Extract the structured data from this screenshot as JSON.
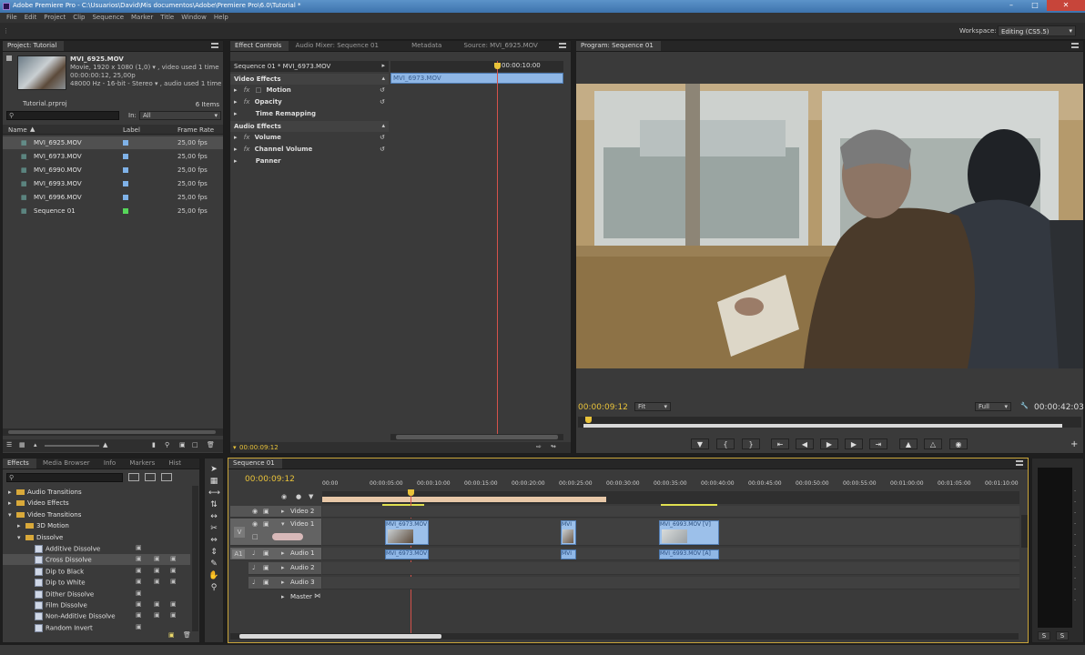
{
  "window": {
    "title": "Adobe Premiere Pro - C:\\Usuarios\\David\\Mis documentos\\Adobe\\Premiere Pro\\6.0\\Tutorial *"
  },
  "menu": [
    "File",
    "Edit",
    "Project",
    "Clip",
    "Sequence",
    "Marker",
    "Title",
    "Window",
    "Help"
  ],
  "workspace": {
    "label": "Workspace:",
    "value": "Editing (CS5.5)"
  },
  "project": {
    "tab": "Project: Tutorial",
    "clip_name": "MVI_6925.MOV",
    "clip_info": [
      "Movie, 1920 x 1080 (1,0) ▾ , video used 1 time",
      "00:00:00:12, 25,00p",
      "48000 Hz - 16-bit - Stereo ▾ , audio used 1 time"
    ],
    "file": "Tutorial.prproj",
    "in_label": "In:",
    "in_value": "All",
    "count": "6 Items",
    "columns": [
      "Name",
      "Label",
      "Frame Rate"
    ],
    "items": [
      {
        "name": "MVI_6925.MOV",
        "rate": "25,00 fps",
        "color": "#7fb2e8"
      },
      {
        "name": "MVI_6973.MOV",
        "rate": "25,00 fps",
        "color": "#7fb2e8"
      },
      {
        "name": "MVI_6990.MOV",
        "rate": "25,00 fps",
        "color": "#7fb2e8"
      },
      {
        "name": "MVI_6993.MOV",
        "rate": "25,00 fps",
        "color": "#7fb2e8"
      },
      {
        "name": "MVI_6996.MOV",
        "rate": "25,00 fps",
        "color": "#7fb2e8"
      },
      {
        "name": "Sequence 01",
        "rate": "25,00 fps",
        "color": "#56d65a"
      }
    ]
  },
  "effect_controls": {
    "tabs": [
      "Effect Controls",
      "Audio Mixer: Sequence 01",
      "Metadata",
      "Source: MVI_6925.MOV"
    ],
    "sequence": "Sequence 01 * MVI_6973.MOV",
    "timecode_top": "00:00:10:00",
    "clip_label": "MVI_6973.MOV",
    "video_effects": "Video Effects",
    "motion": "Motion",
    "opacity": "Opacity",
    "time_remapping": "Time Remapping",
    "audio_effects": "Audio Effects",
    "volume": "Volume",
    "channel_volume": "Channel Volume",
    "panner": "Panner",
    "timecode": "00:00:09:12"
  },
  "program": {
    "tab": "Program: Sequence 01",
    "timecode": "00:00:09:12",
    "zoom": "Fit",
    "quality": "Full",
    "duration": "00:00:42:03"
  },
  "effects_panel": {
    "tabs": [
      "Effects",
      "Media Browser",
      "Info",
      "Markers",
      "Hist"
    ],
    "items": [
      {
        "label": "Audio Transitions",
        "level": 0,
        "type": "folder"
      },
      {
        "label": "Video Effects",
        "level": 0,
        "type": "folder"
      },
      {
        "label": "Video Transitions",
        "level": 0,
        "type": "folder"
      },
      {
        "label": "3D Motion",
        "level": 1,
        "type": "folder"
      },
      {
        "label": "Dissolve",
        "level": 1,
        "type": "folder"
      },
      {
        "label": "Additive Dissolve",
        "level": 2,
        "type": "fx"
      },
      {
        "label": "Cross Dissolve",
        "level": 2,
        "type": "fx"
      },
      {
        "label": "Dip to Black",
        "level": 2,
        "type": "fx"
      },
      {
        "label": "Dip to White",
        "level": 2,
        "type": "fx"
      },
      {
        "label": "Dither Dissolve",
        "level": 2,
        "type": "fx"
      },
      {
        "label": "Film Dissolve",
        "level": 2,
        "type": "fx"
      },
      {
        "label": "Non-Additive Dissolve",
        "level": 2,
        "type": "fx"
      },
      {
        "label": "Random Invert",
        "level": 2,
        "type": "fx"
      }
    ]
  },
  "timeline": {
    "tab": "Sequence 01",
    "timecode": "00:00:09:12",
    "ruler": [
      "00:00",
      "00:00:05:00",
      "00:00:10:00",
      "00:00:15:00",
      "00:00:20:00",
      "00:00:25:00",
      "00:00:30:00",
      "00:00:35:00",
      "00:00:40:00",
      "00:00:45:00",
      "00:00:50:00",
      "00:00:55:00",
      "00:01:00:00",
      "00:01:05:00",
      "00:01:10:00"
    ],
    "tracks": [
      "Video 2",
      "Video 1",
      "Audio 1",
      "Audio 2",
      "Audio 3",
      "Master"
    ],
    "track_targets": [
      "V",
      "A1"
    ],
    "clips": [
      {
        "label": "MVI_6973.MOV",
        "track": "v1"
      },
      {
        "label": "MVI",
        "track": "v1"
      },
      {
        "label": "MVI_6993.MOV [V]",
        "track": "v1"
      },
      {
        "label": "MVI_6973.MOV",
        "track": "a1"
      },
      {
        "label": "MVI",
        "track": "a1"
      },
      {
        "label": "MVI_6993.MOV [A]",
        "track": "a1"
      }
    ]
  },
  "meter": {
    "buttons": [
      "S",
      "S"
    ]
  }
}
